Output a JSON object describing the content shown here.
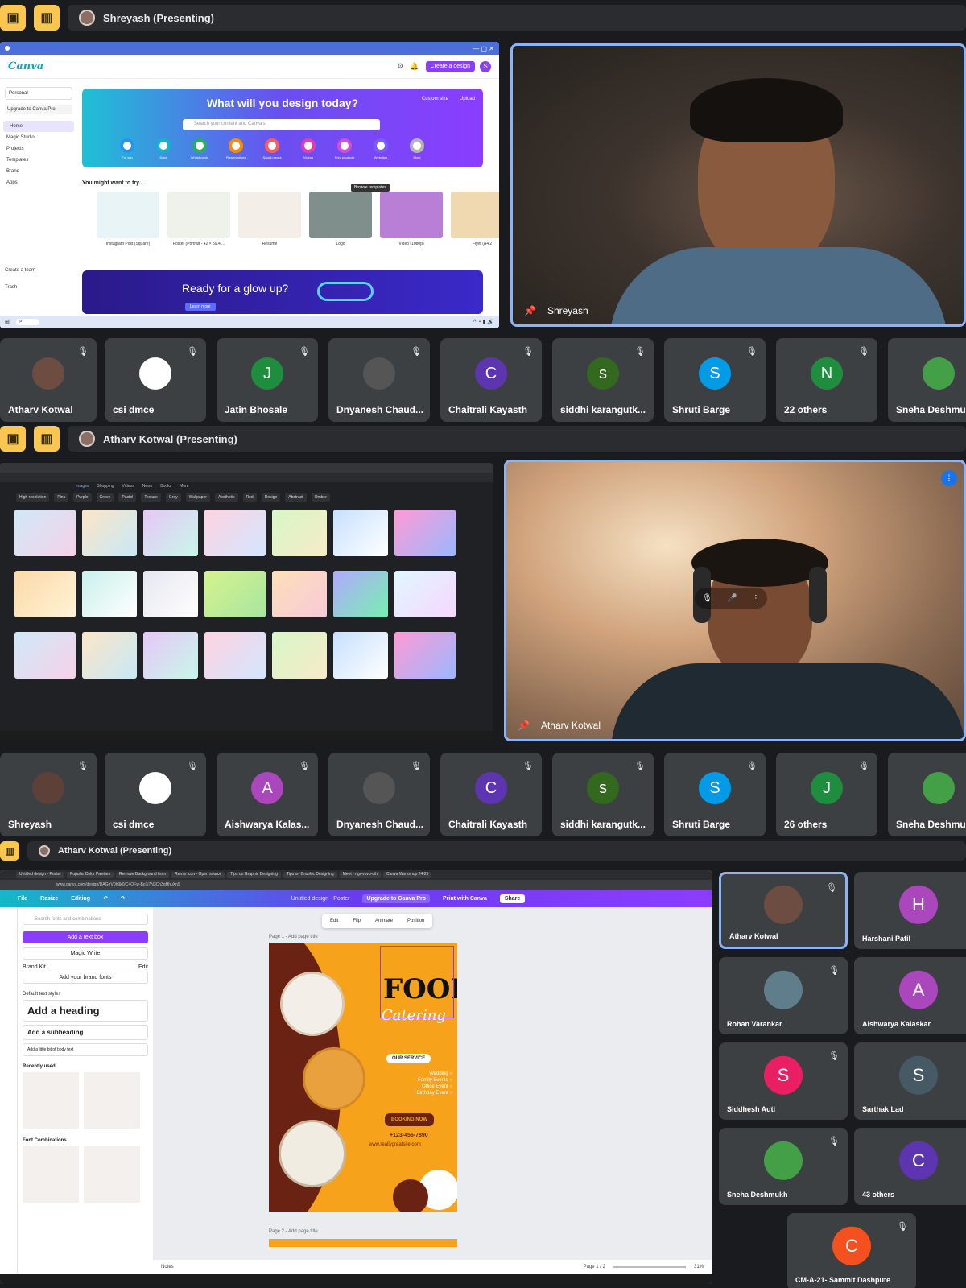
{
  "section1": {
    "presenter": "Shreyash (Presenting)",
    "canva": {
      "brand": "Canva",
      "create_button": "Create a design",
      "account": "Personal",
      "upgrade": "Upgrade to Canva Pro",
      "nav": [
        "Home",
        "Magic Studio",
        "Projects",
        "Templates",
        "Brand",
        "Apps"
      ],
      "hero_title": "What will you design today?",
      "hero_links": [
        "Custom size",
        "Upload"
      ],
      "search_placeholder": "Search your content and Canva's",
      "categories": [
        "For you",
        "Docs",
        "Whiteboards",
        "Presentations",
        "Social media",
        "Videos",
        "Print products",
        "Websites",
        "More"
      ],
      "suggest_title": "You might want to try...",
      "templates": [
        "Instagram Post (Square)",
        "Poster (Portrait - 42 × 59.4 ...",
        "Resume",
        "Logo",
        "Video (1080p)",
        "Flyer (A4 2"
      ],
      "tooltip": "Browse templates",
      "create_team": "Create a team",
      "trash": "Trash",
      "banner": "Ready for a glow up?",
      "banner_button": "Learn more"
    },
    "pinned_name": "Shreyash",
    "tiles": [
      {
        "name": "Atharv Kotwal",
        "letter": "",
        "color": "#6d4c41"
      },
      {
        "name": "csi dmce",
        "letter": "",
        "color": "#ffffff"
      },
      {
        "name": "Jatin Bhosale",
        "letter": "J",
        "color": "#1e8e3e"
      },
      {
        "name": "Dnyanesh Chaud...",
        "letter": "",
        "color": "#555555"
      },
      {
        "name": "Chaitrali Kayasth",
        "letter": "C",
        "color": "#5e35b1"
      },
      {
        "name": "siddhi karangutk...",
        "letter": "s",
        "color": "#33691e"
      },
      {
        "name": "Shruti Barge",
        "letter": "S",
        "color": "#039be5"
      },
      {
        "name": "22 others",
        "letter": "N",
        "color": "#1e8e3e"
      },
      {
        "name": "Sneha Deshmukh",
        "letter": "",
        "color": "#43a047"
      }
    ]
  },
  "section2": {
    "presenter": "Atharv Kotwal (Presenting)",
    "search_tabs": [
      "Images",
      "Shopping",
      "Videos",
      "News",
      "Books",
      "More"
    ],
    "filter_chips": [
      "High resolution",
      "Pink",
      "Purple",
      "Green",
      "Pastel",
      "Texture",
      "Grey",
      "Wallpaper",
      "Aesthetic",
      "Red",
      "Design",
      "Abstract",
      "Ombre"
    ],
    "pinned_name": "Atharv Kotwal",
    "tiles": [
      {
        "name": "Shreyash",
        "letter": "",
        "color": "#5d4037"
      },
      {
        "name": "csi dmce",
        "letter": "",
        "color": "#ffffff"
      },
      {
        "name": "Aishwarya Kalas...",
        "letter": "A",
        "color": "#ab47bc"
      },
      {
        "name": "Dnyanesh Chaud...",
        "letter": "",
        "color": "#555555"
      },
      {
        "name": "Chaitrali Kayasth",
        "letter": "C",
        "color": "#5e35b1"
      },
      {
        "name": "siddhi karangutk...",
        "letter": "s",
        "color": "#33691e"
      },
      {
        "name": "Shruti Barge",
        "letter": "S",
        "color": "#039be5"
      },
      {
        "name": "26 others",
        "letter": "J",
        "color": "#1e8e3e"
      },
      {
        "name": "Sneha Deshmukh",
        "letter": "",
        "color": "#43a047"
      }
    ]
  },
  "section3": {
    "presenter": "Atharv Kotwal (Presenting)",
    "browser_tabs": [
      "Untitled design - Poster",
      "Popular Color Palettes",
      "Remove Background from",
      "Remix Icon - Open source",
      "Tips on Graphic Designing",
      "Tips on Graphic Designing",
      "Meet - ngr-vbvb-uih",
      "Canva Workshop 24-25"
    ],
    "url": "www.canva.com/design/DAGfrV0h9k0/C4OFw-Bo1j7N3Ch3qHhuXn9",
    "menu": {
      "file": "File",
      "resize": "Resize",
      "editing": "Editing",
      "doc_title": "Untitled design - Poster",
      "upgrade": "Upgrade to Canva Pro",
      "print": "Print with Canva",
      "share": "Share"
    },
    "left_panel": {
      "search_placeholder": "Search fonts and combinations",
      "add_text": "Add a text box",
      "magic_write": "Magic Write",
      "brand_kit": "Brand Kit",
      "edit": "Edit",
      "brand_fonts": "Add your brand fonts",
      "default_styles": "Default text styles",
      "heading": "Add a heading",
      "subheading": "Add a subheading",
      "body": "Add a little bit of body text",
      "recent": "Recently used",
      "combos": "Font Combinations"
    },
    "toolbar": [
      "Edit",
      "Flip",
      "Animate",
      "Position"
    ],
    "page1": "Page 1 - Add page title",
    "page2": "Page 2 - Add page title",
    "poster": {
      "title": "FOOD",
      "subtitle": "Catering",
      "service_label": "OUR SERVICE",
      "services": [
        "Wedding",
        "Family Events",
        "Office Event",
        "Birthday Event"
      ],
      "booking": "BOOKING NOW",
      "phone": "+123-456-7890",
      "site": "www.reallygreatsite.com"
    },
    "notes": "Notes",
    "page_counter": "Page 1 / 2",
    "zoom": "31%",
    "grid": [
      {
        "name": "Atharv Kotwal",
        "letter": "",
        "color": "#6d4c41"
      },
      {
        "name": "Harshani Patil",
        "letter": "H",
        "color": "#ab47bc"
      },
      {
        "name": "Rohan Varankar",
        "letter": "",
        "color": "#607d8b"
      },
      {
        "name": "Aishwarya Kalaskar",
        "letter": "A",
        "color": "#ab47bc"
      },
      {
        "name": "Siddhesh Auti",
        "letter": "S",
        "color": "#e91e63"
      },
      {
        "name": "Sarthak Lad",
        "letter": "S",
        "color": "#455a64"
      },
      {
        "name": "Sneha Deshmukh",
        "letter": "",
        "color": "#43a047"
      },
      {
        "name": "43 others",
        "letter": "C",
        "color": "#5e35b1"
      },
      {
        "name": "CM-A-21- Sammit Dashpute",
        "letter": "C",
        "color": "#f4511e"
      }
    ]
  }
}
